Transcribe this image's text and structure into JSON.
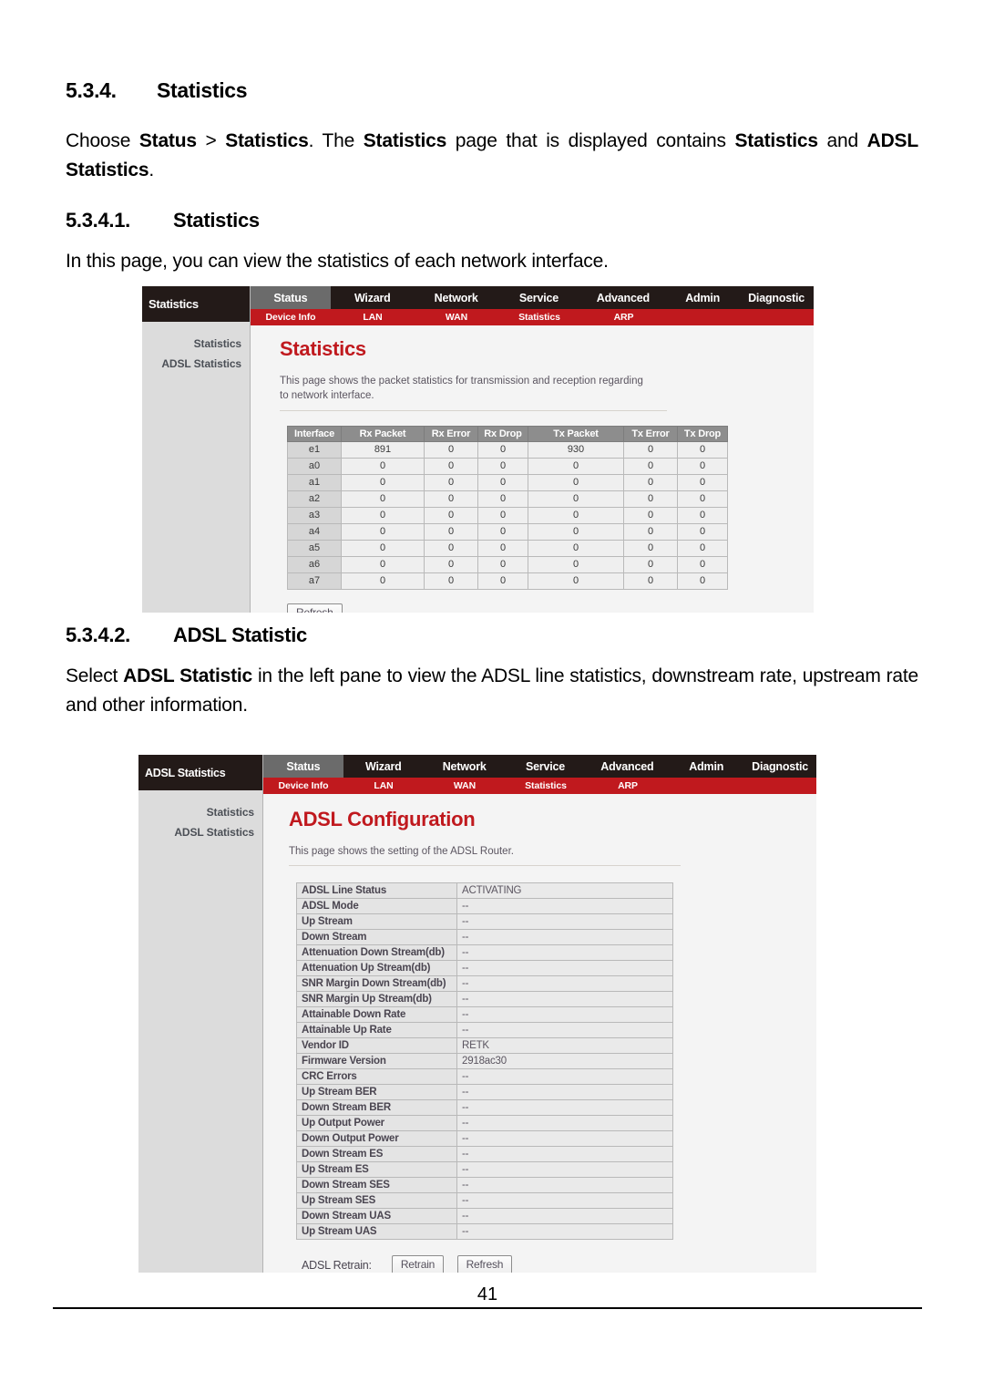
{
  "document": {
    "section1": {
      "number": "5.3.4.",
      "title": "Statistics",
      "paragraph": {
        "part1": "Choose ",
        "b1": "Status",
        "part2": " > ",
        "b2": "Statistics",
        "part3": ". The ",
        "b3": "Statistics",
        "part4": " page that is displayed contains ",
        "b4": "Statistics",
        "part5": " and ",
        "b5": "ADSL Statistics",
        "part6": "."
      }
    },
    "section2": {
      "number": "5.3.4.1.",
      "title": "Statistics",
      "paragraph": "In this page, you can view the statistics of each network interface."
    },
    "section3": {
      "number": "5.3.4.2.",
      "title": "ADSL Statistic",
      "paragraph": {
        "part1": "Select ",
        "b1": "ADSL Statistic",
        "part2": " in the left pane to view the ADSL line statistics, downstream rate, upstream rate and other information."
      }
    },
    "footer": {
      "page_number": "41"
    }
  },
  "colors": {
    "nav_dark": "#231a18",
    "nav_active": "#6b6b6b",
    "subnav_red": "#c0191e",
    "title_red": "#c0191e",
    "sidebar_gray": "#dcdcdc",
    "table_header_gray": "#8d8d8d"
  },
  "screenshot1": {
    "sidebar": {
      "title": "Statistics",
      "items": [
        {
          "label": "Statistics"
        },
        {
          "label": "ADSL Statistics"
        }
      ]
    },
    "nav": {
      "tabs": [
        {
          "label": "Status",
          "active": true
        },
        {
          "label": "Wizard",
          "active": false
        },
        {
          "label": "Network",
          "active": false
        },
        {
          "label": "Service",
          "active": false
        },
        {
          "label": "Advanced",
          "active": false
        },
        {
          "label": "Admin",
          "active": false
        },
        {
          "label": "Diagnostic",
          "active": false
        }
      ]
    },
    "subnav": {
      "tabs": [
        {
          "label": "Device Info"
        },
        {
          "label": "LAN"
        },
        {
          "label": "WAN"
        },
        {
          "label": "Statistics"
        },
        {
          "label": "ARP"
        }
      ]
    },
    "page": {
      "title": "Statistics",
      "description": "This page shows the packet statistics for transmission and reception regarding to network interface.",
      "refresh_label": "Refresh"
    },
    "table": {
      "headers": [
        "Interface",
        "Rx Packet",
        "Rx Error",
        "Rx Drop",
        "Tx Packet",
        "Tx Error",
        "Tx Drop"
      ],
      "rows": [
        [
          "e1",
          "891",
          "0",
          "0",
          "930",
          "0",
          "0"
        ],
        [
          "a0",
          "0",
          "0",
          "0",
          "0",
          "0",
          "0"
        ],
        [
          "a1",
          "0",
          "0",
          "0",
          "0",
          "0",
          "0"
        ],
        [
          "a2",
          "0",
          "0",
          "0",
          "0",
          "0",
          "0"
        ],
        [
          "a3",
          "0",
          "0",
          "0",
          "0",
          "0",
          "0"
        ],
        [
          "a4",
          "0",
          "0",
          "0",
          "0",
          "0",
          "0"
        ],
        [
          "a5",
          "0",
          "0",
          "0",
          "0",
          "0",
          "0"
        ],
        [
          "a6",
          "0",
          "0",
          "0",
          "0",
          "0",
          "0"
        ],
        [
          "a7",
          "0",
          "0",
          "0",
          "0",
          "0",
          "0"
        ]
      ]
    }
  },
  "screenshot2": {
    "sidebar": {
      "title": "ADSL Statistics",
      "items": [
        {
          "label": "Statistics"
        },
        {
          "label": "ADSL Statistics"
        }
      ]
    },
    "nav": {
      "tabs": [
        {
          "label": "Status",
          "active": true
        },
        {
          "label": "Wizard",
          "active": false
        },
        {
          "label": "Network",
          "active": false
        },
        {
          "label": "Service",
          "active": false
        },
        {
          "label": "Advanced",
          "active": false
        },
        {
          "label": "Admin",
          "active": false
        },
        {
          "label": "Diagnostic",
          "active": false
        }
      ]
    },
    "subnav": {
      "tabs": [
        {
          "label": "Device Info"
        },
        {
          "label": "LAN"
        },
        {
          "label": "WAN"
        },
        {
          "label": "Statistics"
        },
        {
          "label": "ARP"
        }
      ]
    },
    "page": {
      "title": "ADSL Configuration",
      "description": "This page shows the setting of the ADSL Router.",
      "retrain_label": "ADSL Retrain:",
      "retrain_button": "Retrain",
      "refresh_button": "Refresh"
    },
    "table": {
      "rows": [
        [
          "ADSL Line Status",
          "ACTIVATING"
        ],
        [
          "ADSL Mode",
          "--"
        ],
        [
          "Up Stream",
          "--"
        ],
        [
          "Down Stream",
          "--"
        ],
        [
          "Attenuation Down Stream(db)",
          "--"
        ],
        [
          "Attenuation Up Stream(db)",
          "--"
        ],
        [
          "SNR Margin Down Stream(db)",
          "--"
        ],
        [
          "SNR Margin Up Stream(db)",
          "--"
        ],
        [
          "Attainable Down Rate",
          "--"
        ],
        [
          "Attainable Up Rate",
          "--"
        ],
        [
          "Vendor ID",
          "RETK"
        ],
        [
          "Firmware Version",
          "2918ac30"
        ],
        [
          "CRC Errors",
          "--"
        ],
        [
          "Up Stream BER",
          "--"
        ],
        [
          "Down Stream BER",
          "--"
        ],
        [
          "Up Output Power",
          "--"
        ],
        [
          "Down Output Power",
          "--"
        ],
        [
          "Down Stream ES",
          "--"
        ],
        [
          "Up Stream ES",
          "--"
        ],
        [
          "Down Stream SES",
          "--"
        ],
        [
          "Up Stream SES",
          "--"
        ],
        [
          "Down Stream UAS",
          "--"
        ],
        [
          "Up Stream UAS",
          "--"
        ]
      ]
    }
  }
}
